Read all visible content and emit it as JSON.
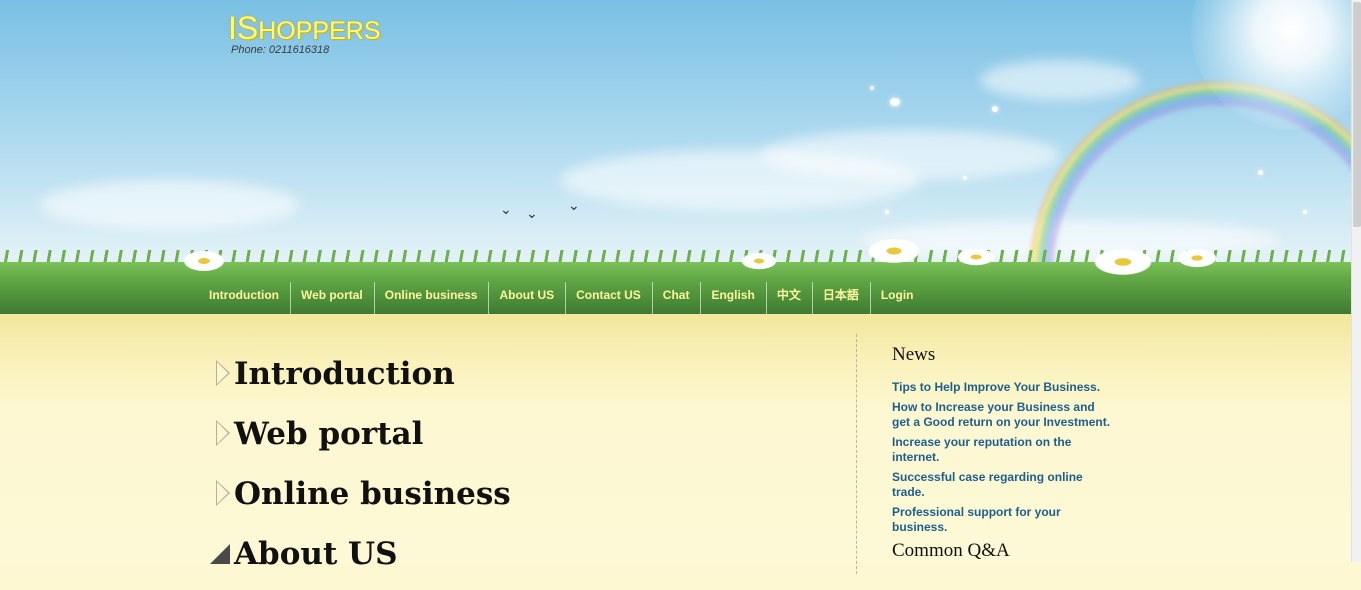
{
  "header": {
    "logo": {
      "part1": "IS",
      "part2": "HOPPERS",
      "phone": "Phone: 0211616318"
    },
    "nav": [
      {
        "label": "Introduction"
      },
      {
        "label": "Web portal"
      },
      {
        "label": "Online business"
      },
      {
        "label": "About US"
      },
      {
        "label": "Contact US"
      },
      {
        "label": "Chat"
      },
      {
        "label": "English"
      },
      {
        "label": "中文"
      },
      {
        "label": "日本語"
      },
      {
        "label": "Login"
      }
    ]
  },
  "main": {
    "sections": [
      {
        "label": "Introduction",
        "expanded": false
      },
      {
        "label": "Web portal",
        "expanded": false
      },
      {
        "label": "Online business",
        "expanded": false
      },
      {
        "label": "About US",
        "expanded": true
      }
    ]
  },
  "sidebar": {
    "news_title": "News",
    "news": [
      {
        "text": "Tips to Help Improve Your Business."
      },
      {
        "text": "How to Increase your Business and get a Good return on your Investment."
      },
      {
        "text": "Increase your reputation on the internet."
      },
      {
        "text": "Successful case regarding online trade."
      },
      {
        "text": "Professional support for your business."
      }
    ],
    "qa_title": "Common Q&A"
  },
  "colors": {
    "nav_text": "#fff6a0",
    "news_link": "#1d5f8c",
    "content_bg": "#fdf8d2"
  }
}
